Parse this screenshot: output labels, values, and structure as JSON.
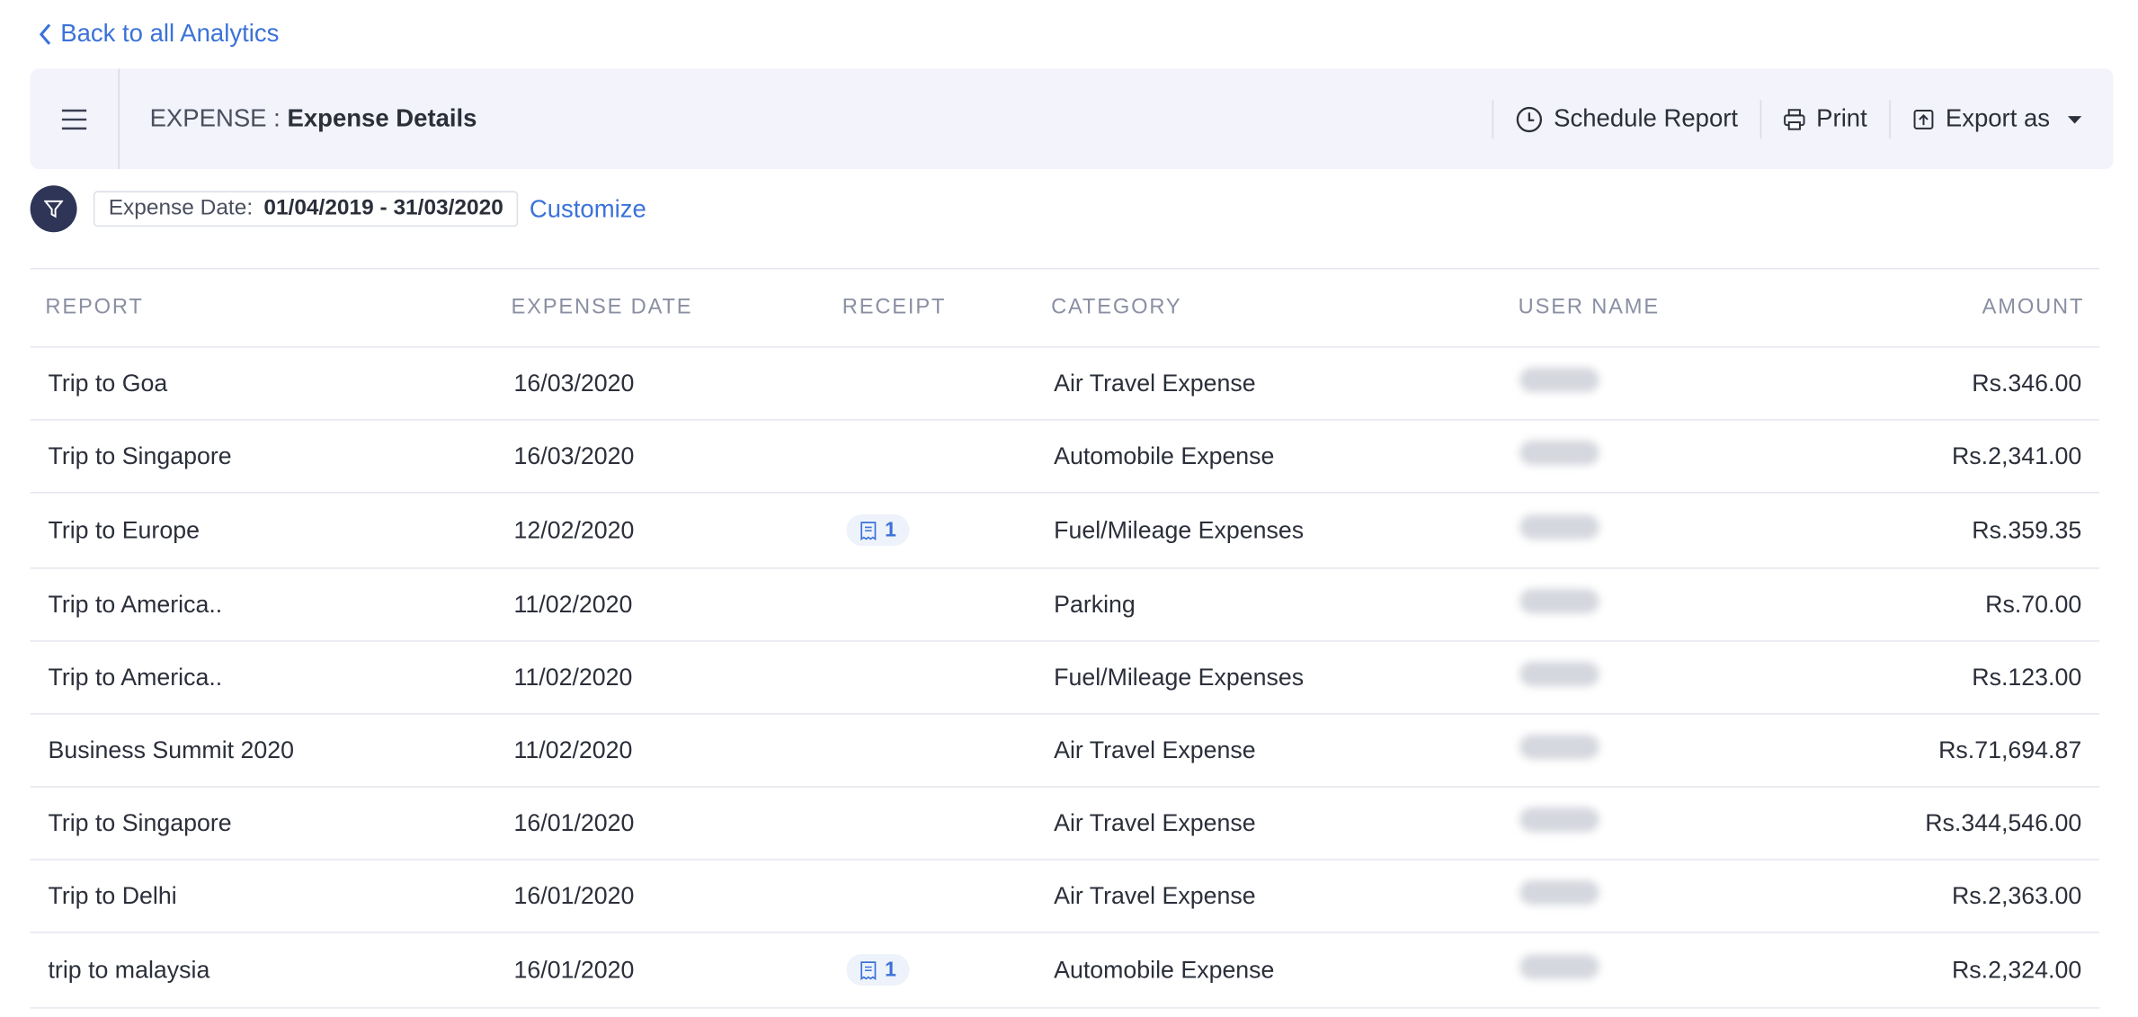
{
  "nav": {
    "back_label": "Back to all Analytics"
  },
  "header": {
    "module": "EXPENSE :",
    "title": "Expense Details",
    "actions": {
      "schedule": "Schedule Report",
      "print": "Print",
      "export": "Export as"
    }
  },
  "filter": {
    "label": "Expense Date:",
    "value": "01/04/2019 - 31/03/2020",
    "customize": "Customize"
  },
  "table": {
    "columns": {
      "report": "REPORT",
      "expense_date": "EXPENSE DATE",
      "receipt": "RECEIPT",
      "category": "CATEGORY",
      "user_name": "USER NAME",
      "amount": "AMOUNT"
    },
    "rows": [
      {
        "report": "Trip to Goa",
        "date": "16/03/2020",
        "receipt": "",
        "category": "Air Travel Expense",
        "amount": "Rs.346.00"
      },
      {
        "report": "Trip to Singapore",
        "date": "16/03/2020",
        "receipt": "",
        "category": "Automobile Expense",
        "amount": "Rs.2,341.00"
      },
      {
        "report": "Trip to Europe",
        "date": "12/02/2020",
        "receipt": "1",
        "category": "Fuel/Mileage Expenses",
        "amount": "Rs.359.35"
      },
      {
        "report": "Trip to America..",
        "date": "11/02/2020",
        "receipt": "",
        "category": "Parking",
        "amount": "Rs.70.00"
      },
      {
        "report": "Trip to America..",
        "date": "11/02/2020",
        "receipt": "",
        "category": "Fuel/Mileage Expenses",
        "amount": "Rs.123.00"
      },
      {
        "report": "Business Summit 2020",
        "date": "11/02/2020",
        "receipt": "",
        "category": "Air Travel Expense",
        "amount": "Rs.71,694.87"
      },
      {
        "report": "Trip to Singapore",
        "date": "16/01/2020",
        "receipt": "",
        "category": "Air Travel Expense",
        "amount": "Rs.344,546.00"
      },
      {
        "report": "Trip to Delhi",
        "date": "16/01/2020",
        "receipt": "",
        "category": "Air Travel Expense",
        "amount": "Rs.2,363.00"
      },
      {
        "report": "trip to malaysia",
        "date": "16/01/2020",
        "receipt": "1",
        "category": "Automobile Expense",
        "amount": "Rs.2,324.00"
      }
    ]
  }
}
